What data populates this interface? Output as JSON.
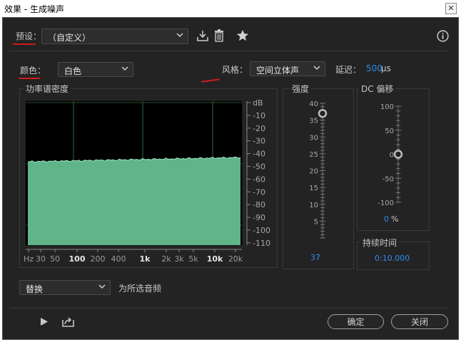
{
  "window": {
    "title": "效果 - 生成噪声",
    "close_glyph": "✕"
  },
  "preset": {
    "label": "预设：",
    "value": "（自定义）"
  },
  "color": {
    "label": "颜色：",
    "value": "白色"
  },
  "style": {
    "label": "风格：",
    "value": "空间立体声"
  },
  "delay": {
    "label": "延迟：",
    "value": "500",
    "unit": "μs"
  },
  "spectrum": {
    "title": "功率谱密度",
    "db_labels": [
      "dB",
      "-10",
      "-20",
      "-30",
      "-40",
      "-50",
      "-60",
      "-70",
      "-80",
      "-90",
      "-100",
      "-110"
    ],
    "hz_labels": [
      "Hz",
      "30",
      "50",
      "100",
      "200",
      "400",
      "1k",
      "2k",
      "3k",
      "5k",
      "10k",
      "20k"
    ],
    "hz_bold": [
      false,
      false,
      false,
      true,
      false,
      false,
      true,
      false,
      false,
      false,
      true,
      false
    ],
    "noise_color": "#5fb48a"
  },
  "intensity": {
    "title": "强度",
    "ticks": [
      "40",
      "35",
      "30",
      "25",
      "20",
      "15",
      "10",
      "5"
    ],
    "value": "37",
    "level": 37,
    "max": 40
  },
  "dc": {
    "title": "DC 偏移",
    "ticks": [
      "100",
      "50",
      "0",
      "-50",
      "-100"
    ],
    "value": "0",
    "unit": "%",
    "level": 0
  },
  "duration": {
    "title": "持续时间",
    "value": "0:10.000"
  },
  "replace": {
    "value": "替换",
    "text": "为所选音频"
  },
  "buttons": {
    "ok": "确定",
    "close": "关闭"
  },
  "icons": [
    "save-preset-icon",
    "delete-icon",
    "favorite-star-icon",
    "info-icon",
    "play-icon",
    "export-icon",
    "chevron-down-icon"
  ],
  "colors": {
    "accent": "#2d8ceb",
    "annotation": "#d01c1c",
    "background": "#232323"
  }
}
